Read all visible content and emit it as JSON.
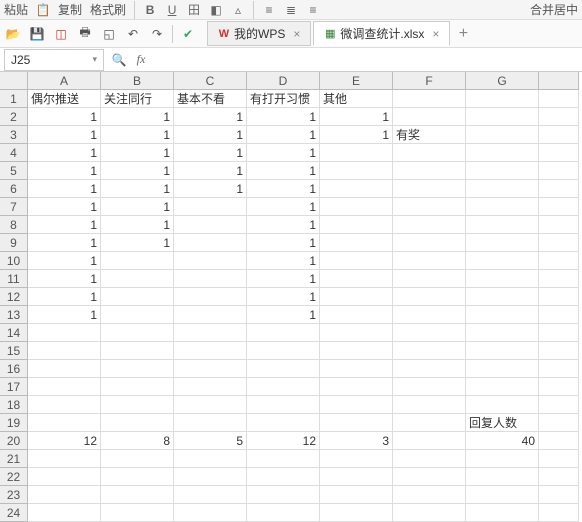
{
  "toolbar_top": {
    "paste_label": "粘贴",
    "copy_label": "复制",
    "format_label": "格式刷",
    "merge_label": "合并居中"
  },
  "tabs": {
    "wps_label": "我的WPS",
    "file_label": "微调查统计.xlsx"
  },
  "formula_bar": {
    "cell_ref": "J25",
    "fx_label": "fx",
    "formula_value": ""
  },
  "columns": [
    "A",
    "B",
    "C",
    "D",
    "E",
    "F",
    "G"
  ],
  "row_count": 24,
  "headers": {
    "A": "偶尔推送",
    "B": "关注同行",
    "C": "基本不看",
    "D": "有打开习惯",
    "E": "其他",
    "F": "",
    "G": ""
  },
  "cells": {
    "2": {
      "A": "1",
      "B": "1",
      "C": "1",
      "D": "1",
      "E": "1"
    },
    "3": {
      "A": "1",
      "B": "1",
      "C": "1",
      "D": "1",
      "E": "1",
      "F": "有奖"
    },
    "4": {
      "A": "1",
      "B": "1",
      "C": "1",
      "D": "1"
    },
    "5": {
      "A": "1",
      "B": "1",
      "C": "1",
      "D": "1"
    },
    "6": {
      "A": "1",
      "B": "1",
      "C": "1",
      "D": "1"
    },
    "7": {
      "A": "1",
      "B": "1",
      "D": "1"
    },
    "8": {
      "A": "1",
      "B": "1",
      "D": "1"
    },
    "9": {
      "A": "1",
      "B": "1",
      "D": "1"
    },
    "10": {
      "A": "1",
      "D": "1"
    },
    "11": {
      "A": "1",
      "D": "1"
    },
    "12": {
      "A": "1",
      "D": "1"
    },
    "13": {
      "A": "1",
      "D": "1"
    },
    "19": {
      "G": "回复人数"
    },
    "20": {
      "A": "12",
      "B": "8",
      "C": "5",
      "D": "12",
      "E": "3",
      "G": "40"
    }
  },
  "chart_data": {
    "type": "table",
    "title": "",
    "columns": [
      "偶尔推送",
      "关注同行",
      "基本不看",
      "有打开习惯",
      "其他",
      "",
      "回复人数"
    ],
    "totals_row": {
      "偶尔推送": 12,
      "关注同行": 8,
      "基本不看": 5,
      "有打开习惯": 12,
      "其他": 3,
      "回复人数": 40
    }
  }
}
